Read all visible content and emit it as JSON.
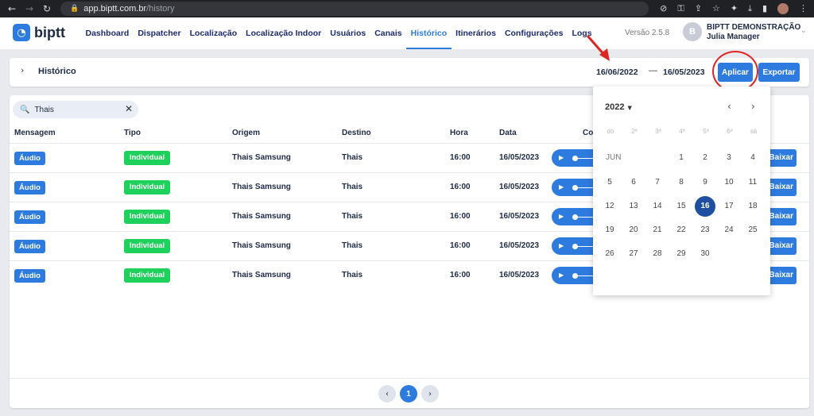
{
  "browser": {
    "url_host": "app.biptt.com.br",
    "url_path": "/history"
  },
  "app": {
    "logo_text": "biptt",
    "version": "Versão 2.5.8",
    "user": {
      "initial": "B",
      "name": "BIPTT DEMONSTRAÇÃO",
      "role": "Julia Manager"
    }
  },
  "nav": {
    "items": [
      {
        "label": "Dashboard",
        "active": false
      },
      {
        "label": "Dispatcher",
        "active": false
      },
      {
        "label": "Localização",
        "active": false
      },
      {
        "label": "Localização Indoor",
        "active": false
      },
      {
        "label": "Usuários",
        "active": false
      },
      {
        "label": "Canais",
        "active": false
      },
      {
        "label": "Histórico",
        "active": true
      },
      {
        "label": "Itinerários",
        "active": false
      },
      {
        "label": "Configurações",
        "active": false
      },
      {
        "label": "Logs",
        "active": false
      }
    ]
  },
  "header": {
    "title": "Histórico",
    "date_from": "16/06/2022",
    "date_sep": "—",
    "date_to": "16/05/2023",
    "apply_label": "Aplicar",
    "export_label": "Exportar"
  },
  "search": {
    "value": "Thais"
  },
  "table": {
    "columns": [
      "Mensagem",
      "Tipo",
      "Origem",
      "Destino",
      "Hora",
      "Data",
      "Co"
    ],
    "download_label": "Baixar",
    "rows": [
      {
        "mensagem": "Áudio",
        "tipo": "Individual",
        "origem": "Thais Samsung",
        "destino": "Thais",
        "hora": "16:00",
        "data": "16/05/2023"
      },
      {
        "mensagem": "Áudio",
        "tipo": "Individual",
        "origem": "Thais Samsung",
        "destino": "Thais",
        "hora": "16:00",
        "data": "16/05/2023"
      },
      {
        "mensagem": "Áudio",
        "tipo": "Individual",
        "origem": "Thais Samsung",
        "destino": "Thais",
        "hora": "16:00",
        "data": "16/05/2023"
      },
      {
        "mensagem": "Áudio",
        "tipo": "Individual",
        "origem": "Thais Samsung",
        "destino": "Thais",
        "hora": "16:00",
        "data": "16/05/2023"
      },
      {
        "mensagem": "Áudio",
        "tipo": "Individual",
        "origem": "Thais Samsung",
        "destino": "Thais",
        "hora": "16:00",
        "data": "16/05/2023"
      }
    ]
  },
  "pagination": {
    "current": "1"
  },
  "datepicker": {
    "year": "2022",
    "month": "JUN",
    "weekdays": [
      "do",
      "2ª",
      "3ª",
      "4ª",
      "5ª",
      "6ª",
      "sá"
    ],
    "days": [
      "1",
      "2",
      "3",
      "4",
      "5",
      "6",
      "7",
      "8",
      "9",
      "10",
      "11",
      "12",
      "13",
      "14",
      "15",
      "16",
      "17",
      "18",
      "19",
      "20",
      "21",
      "22",
      "23",
      "24",
      "25",
      "26",
      "27",
      "28",
      "29",
      "30"
    ],
    "selected_day": "16"
  },
  "colors": {
    "primary": "#2e7be0",
    "success": "#1ed15a",
    "selected_day": "#1e4fa0",
    "annotation_red": "#e02424"
  },
  "icons": [
    "back-arrow-icon",
    "forward-arrow-icon",
    "reload-icon",
    "lock-icon",
    "search-icon",
    "close-icon",
    "chevron-right-icon",
    "chevron-left-icon",
    "chevron-down-icon",
    "play-icon"
  ]
}
